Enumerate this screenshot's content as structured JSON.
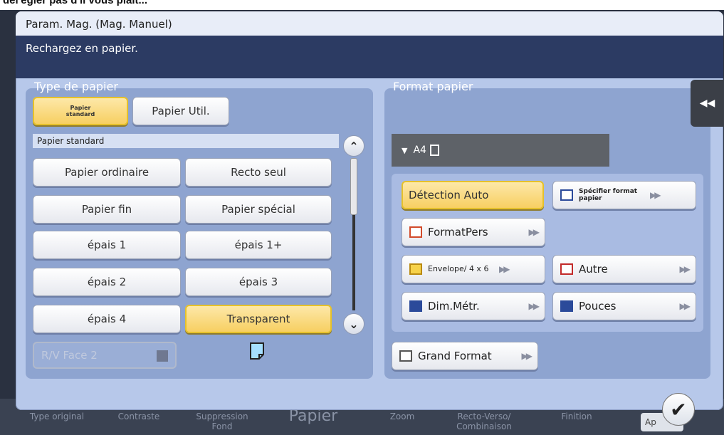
{
  "banner": {
    "text": "del'égler pas d'il vous plait..."
  },
  "dialog": {
    "title": "Param. Mag. (Mag. Manuel)",
    "message": "Rechargez en papier."
  },
  "paper_type": {
    "title": "Type de papier",
    "tabs": [
      {
        "label": "Papier standard",
        "selected": true
      },
      {
        "label": "Papier Util.",
        "selected": false
      }
    ],
    "strip_label": "Papier standard",
    "buttons": [
      {
        "label": "Papier ordinaire",
        "selected": false
      },
      {
        "label": "Recto seul",
        "selected": false
      },
      {
        "label": "Papier fin",
        "selected": false
      },
      {
        "label": "Papier spécial",
        "selected": false
      },
      {
        "label": "épais 1",
        "selected": false
      },
      {
        "label": "épais 1+",
        "selected": false
      },
      {
        "label": "épais 2",
        "selected": false
      },
      {
        "label": "épais 3",
        "selected": false
      },
      {
        "label": "épais 4",
        "selected": false
      },
      {
        "label": "Transparent",
        "selected": true
      }
    ],
    "rv_face": "R/V Face 2"
  },
  "paper_format": {
    "title": "Format papier",
    "current": "A4",
    "buttons": {
      "auto": "Détection Auto",
      "specify": "Spécifier format papier",
      "custom": "FormatPers",
      "envelope": "Envelope/ 4 x 6",
      "other": "Autre",
      "metric": "Dim.Métr.",
      "inch": "Pouces",
      "large": "Grand Format"
    }
  },
  "side_tab": "◀◀",
  "bottom_tabs": [
    "Type original",
    "Contraste",
    "Suppression Fond",
    "Papier",
    "Zoom",
    "Recto-Verso/ Combinaison",
    "Finition"
  ],
  "apply_label": "Ap",
  "ok_symbol": "✔",
  "colors": {
    "accent": "#f7cf62",
    "panel": "#8ea4d0",
    "header": "#2c3b63"
  }
}
